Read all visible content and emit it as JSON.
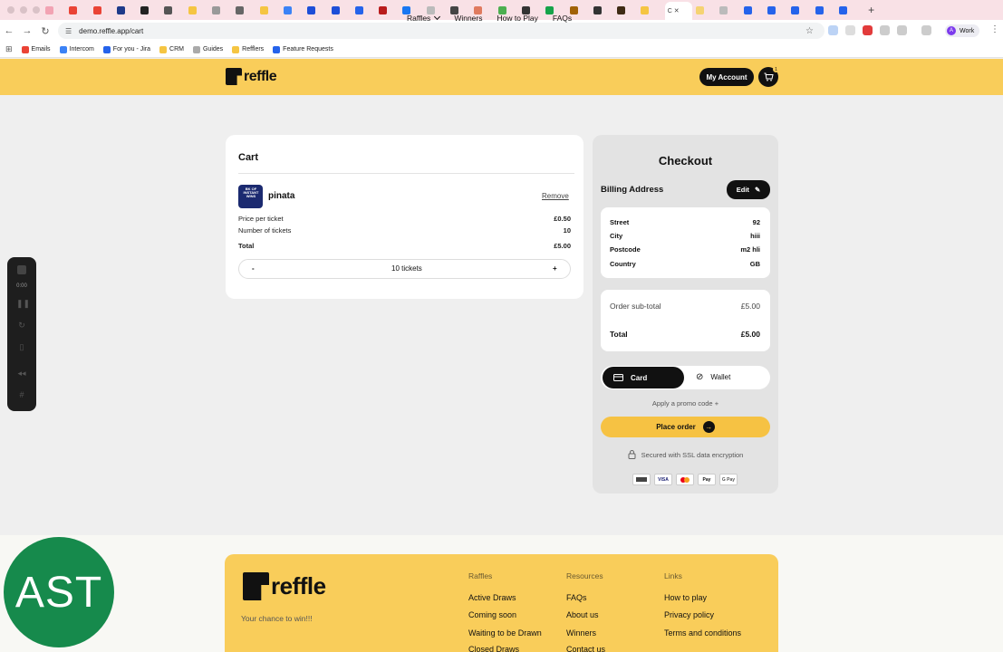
{
  "browser": {
    "url": "demo.reffle.app/cart",
    "active_tab_label": "C",
    "new_tab": "+",
    "profile_label": "Work",
    "profile_initial": "A",
    "bookmarks": [
      "Emails",
      "Intercom",
      "For you - Jira",
      "CRM",
      "Guides",
      "Refflers",
      "Feature Requests"
    ]
  },
  "header": {
    "logo": "reffle",
    "nav": [
      "Raffles",
      "Winners",
      "How to Play",
      "FAQs"
    ],
    "account_button": "My Account",
    "cart_count": "1"
  },
  "cart": {
    "title": "Cart",
    "item": {
      "name": "pinata",
      "thumb_text": "BK OF INSTANT WINS",
      "remove": "Remove",
      "price_label": "Price per ticket",
      "price_value": "£0.50",
      "tickets_label": "Number of tickets",
      "tickets_value": "10",
      "total_label": "Total",
      "total_value": "£5.00"
    },
    "stepper": {
      "minus": "-",
      "value": "10 tickets",
      "plus": "+"
    }
  },
  "checkout": {
    "title": "Checkout",
    "billing_label": "Billing Address",
    "edit": "Edit",
    "address": [
      {
        "k": "Street",
        "v": "92"
      },
      {
        "k": "City",
        "v": "hiii"
      },
      {
        "k": "Postcode",
        "v": "m2 hli"
      },
      {
        "k": "Country",
        "v": "GB"
      }
    ],
    "subtotal_label": "Order sub-total",
    "subtotal_value": "£5.00",
    "total_label": "Total",
    "total_value": "£5.00",
    "pay_card": "Card",
    "pay_wallet": "Wallet",
    "promo": "Apply a promo code",
    "place_order": "Place order",
    "ssl": "Secured with SSL data encryption",
    "pay_logos": [
      "VISA",
      "",
      "Pay",
      "G Pay"
    ]
  },
  "recorder": {
    "time": "0:00"
  },
  "footer": {
    "logo": "reffle",
    "tagline": "Your chance to win!!!",
    "columns": [
      {
        "head": "Raffles",
        "links": [
          "Active Draws",
          "Coming soon",
          "Waiting to be Drawn",
          "Closed Draws"
        ]
      },
      {
        "head": "Resources",
        "links": [
          "FAQs",
          "About us",
          "Winners",
          "Contact us"
        ]
      },
      {
        "head": "Links",
        "links": [
          "How to play",
          "Privacy policy",
          "Terms and conditions"
        ]
      }
    ]
  },
  "overlay": {
    "badge": "AST"
  },
  "colors": {
    "brand_yellow": "#f9cd5a",
    "dark": "#111111",
    "badge_green": "#168a4c"
  }
}
